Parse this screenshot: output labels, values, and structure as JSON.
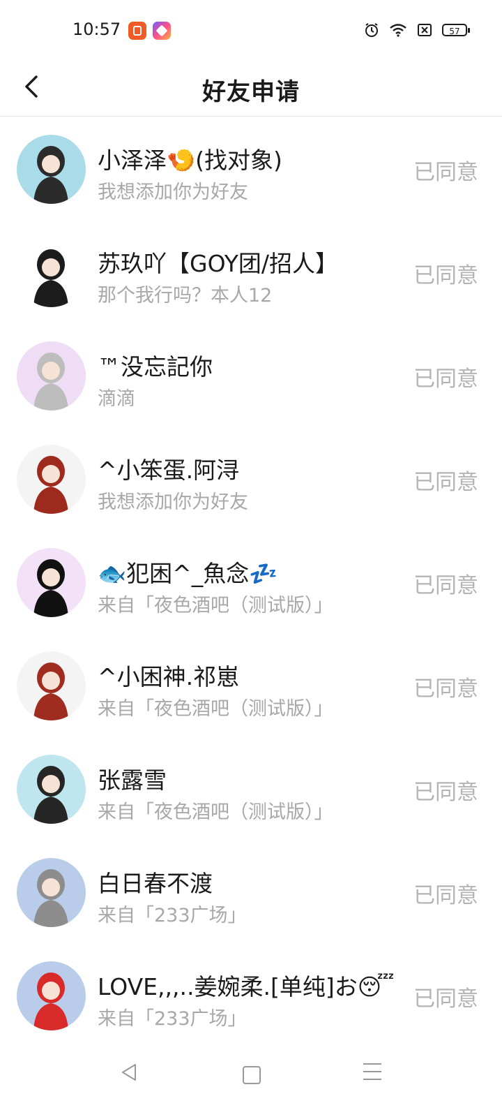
{
  "status_bar": {
    "time": "10:57",
    "battery": "57"
  },
  "header": {
    "title": "好友申请"
  },
  "requests": [
    {
      "name": "小泽泽🍤(找对象)",
      "message": "我想添加你为好友",
      "status": "已同意",
      "avatar_colors": [
        "#a9dbe8",
        "#2b2b2b"
      ]
    },
    {
      "name": "苏玖吖【GOY团/招人】",
      "message": "那个我行吗？本人12",
      "status": "已同意",
      "avatar_colors": [
        "#ffffff",
        "#1c1c1c"
      ]
    },
    {
      "name": "™没忘記你",
      "message": "滴滴",
      "status": "已同意",
      "avatar_colors": [
        "#efdcf5",
        "#bdbdbd"
      ]
    },
    {
      "name": "^小笨蛋.阿浔",
      "message": "我想添加你为好友",
      "status": "已同意",
      "avatar_colors": [
        "#f4f4f4",
        "#9e2a1e"
      ]
    },
    {
      "name": "🐟犯困^_魚念💤",
      "message": "来自「夜色酒吧（测试版）」",
      "status": "已同意",
      "avatar_colors": [
        "#f2e1f7",
        "#111111"
      ]
    },
    {
      "name": "^小困神.祁崽",
      "message": "来自「夜色酒吧（测试版）」",
      "status": "已同意",
      "avatar_colors": [
        "#f4f4f4",
        "#a02c20"
      ]
    },
    {
      "name": "张露雪",
      "message": "来自「夜色酒吧（测试版）」",
      "status": "已同意",
      "avatar_colors": [
        "#bfe6ef",
        "#262626"
      ]
    },
    {
      "name": "白日春不渡",
      "message": "来自「233广场」",
      "status": "已同意",
      "avatar_colors": [
        "#b9cdea",
        "#8d8d8d"
      ]
    },
    {
      "name": "LOVE,,,..姜婉柔.[单纯]お😴",
      "message": "来自「233广场」",
      "status": "已同意",
      "avatar_colors": [
        "#b9cdea",
        "#d92a2a"
      ]
    }
  ]
}
